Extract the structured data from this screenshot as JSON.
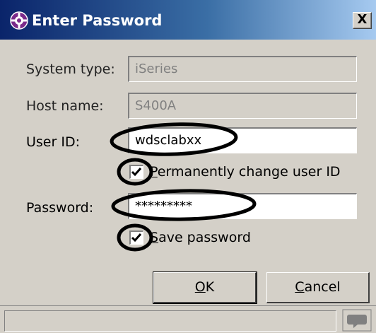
{
  "window": {
    "title": "Enter Password",
    "icon": "perspective-cross-icon",
    "close_label": "X"
  },
  "form": {
    "system_type": {
      "label": "System type:",
      "value": "iSeries",
      "enabled": false
    },
    "host_name": {
      "label": "Host name:",
      "value": "S400A",
      "enabled": false
    },
    "user_id": {
      "label": "User ID:",
      "value": "wdsclabxx",
      "enabled": true
    },
    "change_user": {
      "label": "Permanently change user ID",
      "checked": true
    },
    "password": {
      "label": "Password:",
      "value": "*********",
      "enabled": true
    },
    "save_password": {
      "label": "Save password",
      "checked": true
    }
  },
  "buttons": {
    "ok": {
      "label": "OK",
      "mnemonic": "O"
    },
    "cancel": {
      "label": "Cancel",
      "mnemonic": "C"
    }
  },
  "statusbar": {
    "text": "",
    "icon": "speech-bubble-icon"
  },
  "colors": {
    "title_gradient_start": "#0a246a",
    "title_gradient_end": "#a6caf0",
    "dialog_bg": "#d4d0c8",
    "annotation": "#000000"
  }
}
